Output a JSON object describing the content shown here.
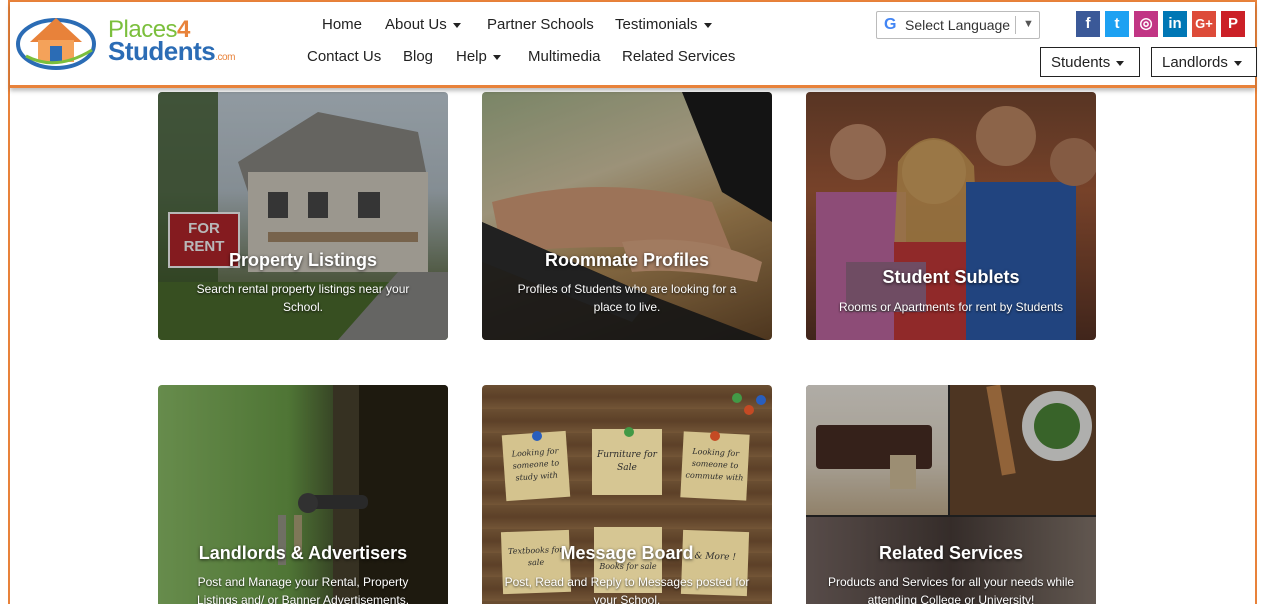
{
  "logo": {
    "line1": "Places",
    "four": "4",
    "line2": "Students",
    "suffix": ".com"
  },
  "nav_row1": [
    {
      "label": "Home",
      "dropdown": false
    },
    {
      "label": "About Us",
      "dropdown": true
    },
    {
      "label": "Partner Schools",
      "dropdown": false
    },
    {
      "label": "Testimonials",
      "dropdown": true
    }
  ],
  "nav_row2": [
    {
      "label": "Contact Us",
      "dropdown": false
    },
    {
      "label": "Blog",
      "dropdown": false
    },
    {
      "label": "Help",
      "dropdown": true
    },
    {
      "label": "Multimedia",
      "dropdown": false
    },
    {
      "label": "Related Services",
      "dropdown": false
    }
  ],
  "language": {
    "g": "G",
    "label": "Select Language",
    "arrow": "▼"
  },
  "social": [
    {
      "icon": "facebook-icon",
      "glyph": "f",
      "color": "#3b5998"
    },
    {
      "icon": "twitter-icon",
      "glyph": "t",
      "color": "#1da1f2"
    },
    {
      "icon": "instagram-icon",
      "glyph": "◎",
      "color": "#c13584"
    },
    {
      "icon": "linkedin-icon",
      "glyph": "in",
      "color": "#0077b5"
    },
    {
      "icon": "google-plus-icon",
      "glyph": "G+",
      "color": "#dd4b39"
    },
    {
      "icon": "pinterest-icon",
      "glyph": "P",
      "color": "#cb2027"
    }
  ],
  "buttons": {
    "students": "Students",
    "landlords": "Landlords"
  },
  "tiles": [
    {
      "title": "Property Listings",
      "desc": "Search rental property listings near your School."
    },
    {
      "title": "Roommate Profiles",
      "desc": "Profiles of Students who are looking for a place to live."
    },
    {
      "title": "Student Sublets",
      "desc": "Rooms or Apartments for rent by Students"
    },
    {
      "title": "Landlords & Advertisers",
      "desc": "Post and Manage your Rental, Property Listings and/ or Banner Advertisements."
    },
    {
      "title": "Message Board",
      "desc": "Post, Read and Reply to Messages posted for your School."
    },
    {
      "title": "Related Services",
      "desc": "Products and Services for all your needs while attending College or University!"
    }
  ],
  "sign": {
    "line1": "FOR",
    "line2": "RENT"
  },
  "notes": [
    "Looking for someone to study with",
    "Furniture for Sale",
    "Looking for someone to commute with",
    "Textbooks for sale",
    "Books for sale",
    "& More !"
  ],
  "colors": {
    "accent": "#e8823a",
    "brand_blue": "#2b6cb5",
    "brand_green": "#7bbf3c"
  }
}
